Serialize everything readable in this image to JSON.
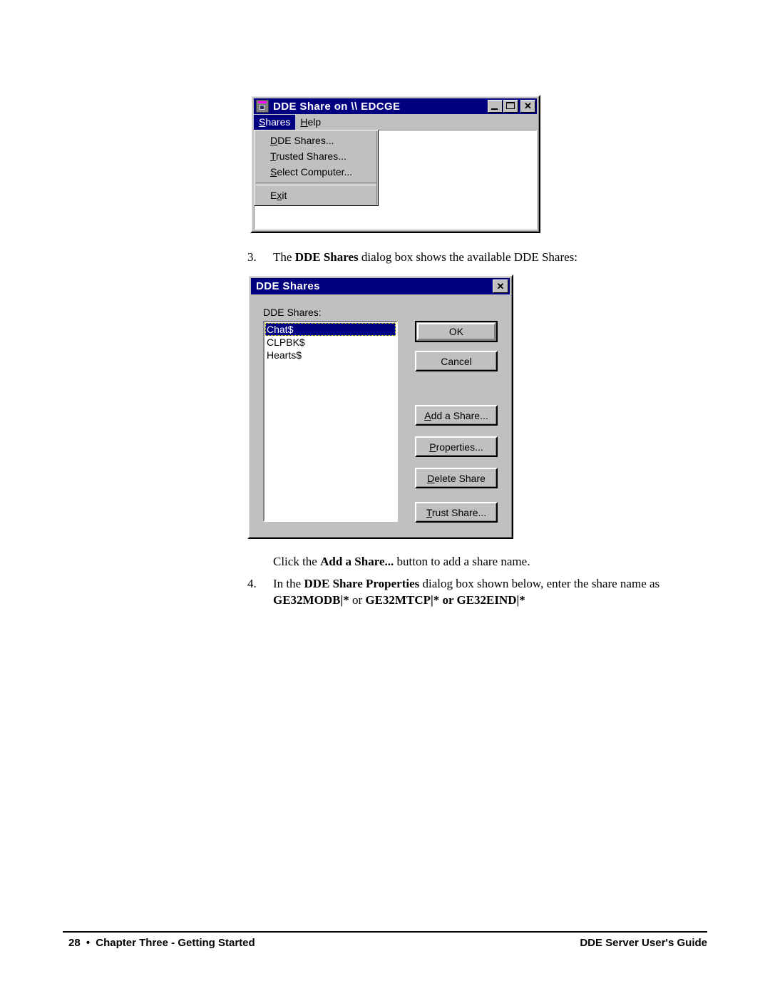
{
  "page": {
    "number": "28",
    "bullet": "•",
    "footer_left": "Chapter Three - Getting Started",
    "footer_right": "DDE Server User's Guide"
  },
  "window_main": {
    "icon": "dde-share-app-icon",
    "title": "DDE Share on \\\\ EDCGE",
    "controls": {
      "minimize": "minimize-icon",
      "maximize": "maximize-icon",
      "close": "✕"
    },
    "menubar": [
      {
        "label_pre": "S",
        "label_post": "hares",
        "active": true
      },
      {
        "label_pre": "H",
        "label_post": "elp",
        "active": false
      }
    ],
    "dropdown": {
      "items": [
        {
          "pre": "DD",
          "mid": "E",
          "post": " Shares...",
          "accel": "D"
        },
        {
          "accel": "T",
          "rest": "rusted Shares..."
        },
        {
          "accel": "S",
          "rest": "elect Computer..."
        },
        {
          "separator": true
        },
        {
          "accel": "E",
          "mid": "x",
          "rest": "it"
        }
      ],
      "item_1": "DDE Shares...",
      "item_2": "Trusted Shares...",
      "item_3": "Select Computer...",
      "item_4": "Exit"
    }
  },
  "step3": {
    "number": "3.",
    "text_a": "The ",
    "text_b": "DDE Shares",
    "text_c": " dialog box shows the available DDE Shares:"
  },
  "dialog_dde_shares": {
    "title": "DDE Shares",
    "close_glyph": "✕",
    "list_label": "DDE Shares:",
    "list_items": [
      {
        "label": "Chat$",
        "selected": true
      },
      {
        "label": "CLPBK$",
        "selected": false
      },
      {
        "label": "Hearts$",
        "selected": false
      }
    ],
    "buttons": [
      {
        "label": "OK",
        "accel": "",
        "default": true
      },
      {
        "label": "Cancel",
        "accel": "",
        "default": false
      },
      {
        "label": "Add a Share...",
        "accel": "A",
        "default": false
      },
      {
        "label": "Properties...",
        "accel": "P",
        "default": false
      },
      {
        "label": "Delete Share",
        "accel": "D",
        "default": false
      },
      {
        "label": "Trust Share...",
        "accel": "T",
        "default": false
      }
    ],
    "btn_ok": "OK",
    "btn_cancel": "Cancel",
    "btn_add_pre": "A",
    "btn_add_post": "dd a Share...",
    "btn_props_pre": "P",
    "btn_props_post": "roperties...",
    "btn_delete_pre": "D",
    "btn_delete_post": "elete Share",
    "btn_trust_pre": "T",
    "btn_trust_post": "rust Share..."
  },
  "caption_click": {
    "text_a": "Click the ",
    "text_b": "Add a Share...",
    "text_c": " button to add a share name."
  },
  "step4": {
    "number": "4.",
    "line1_a": "In the ",
    "line1_b": "DDE Share Properties",
    "line1_c": " dialog box shown below, enter the share name as",
    "line2_a": "GE32MODB|*",
    "line2_b": " or ",
    "line2_c": "GE32MTCP|* or GE32EIND|*"
  },
  "colors": {
    "titlebar": "#000080",
    "face": "#c0c0c0",
    "highlight_text": "#ffffff",
    "selection": "#000080",
    "focus_outline": "#ffff00"
  }
}
